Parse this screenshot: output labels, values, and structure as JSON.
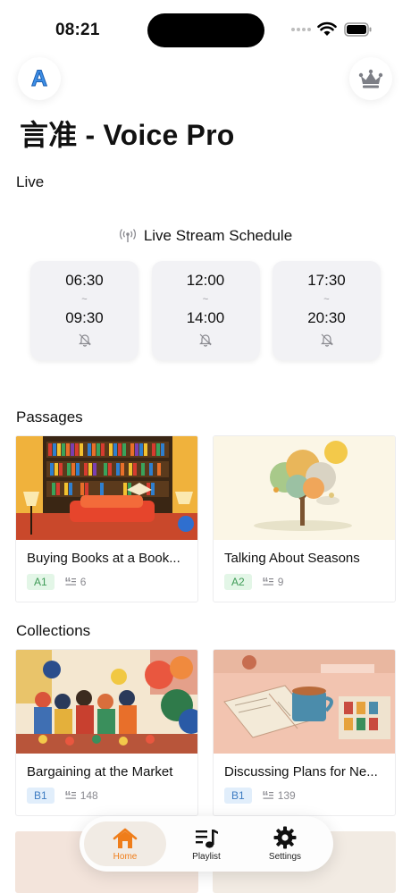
{
  "status_bar": {
    "time": "08:21"
  },
  "header": {
    "title": "言准 - Voice Pro",
    "left_button_letter": "A"
  },
  "live": {
    "section_title": "Live",
    "schedule_title": "Live Stream Schedule",
    "slots": [
      {
        "start": "06:30",
        "separator": "~",
        "end": "09:30"
      },
      {
        "start": "12:00",
        "separator": "~",
        "end": "14:00"
      },
      {
        "start": "17:30",
        "separator": "~",
        "end": "20:30"
      }
    ]
  },
  "passages": {
    "section_title": "Passages",
    "items": [
      {
        "title": "Buying Books at a Book...",
        "level": "A1",
        "count": "6"
      },
      {
        "title": "Talking About Seasons",
        "level": "A2",
        "count": "9"
      }
    ]
  },
  "collections": {
    "section_title": "Collections",
    "items": [
      {
        "title": "Bargaining at the Market",
        "level": "B1",
        "count": "148"
      },
      {
        "title": "Discussing Plans for Ne...",
        "level": "B1",
        "count": "139"
      }
    ]
  },
  "tab_bar": {
    "tabs": [
      {
        "label": "Home",
        "icon": "home-icon"
      },
      {
        "label": "Playlist",
        "icon": "playlist-icon"
      },
      {
        "label": "Settings",
        "icon": "gear-icon"
      }
    ],
    "active_color": "#ef7d1a"
  }
}
